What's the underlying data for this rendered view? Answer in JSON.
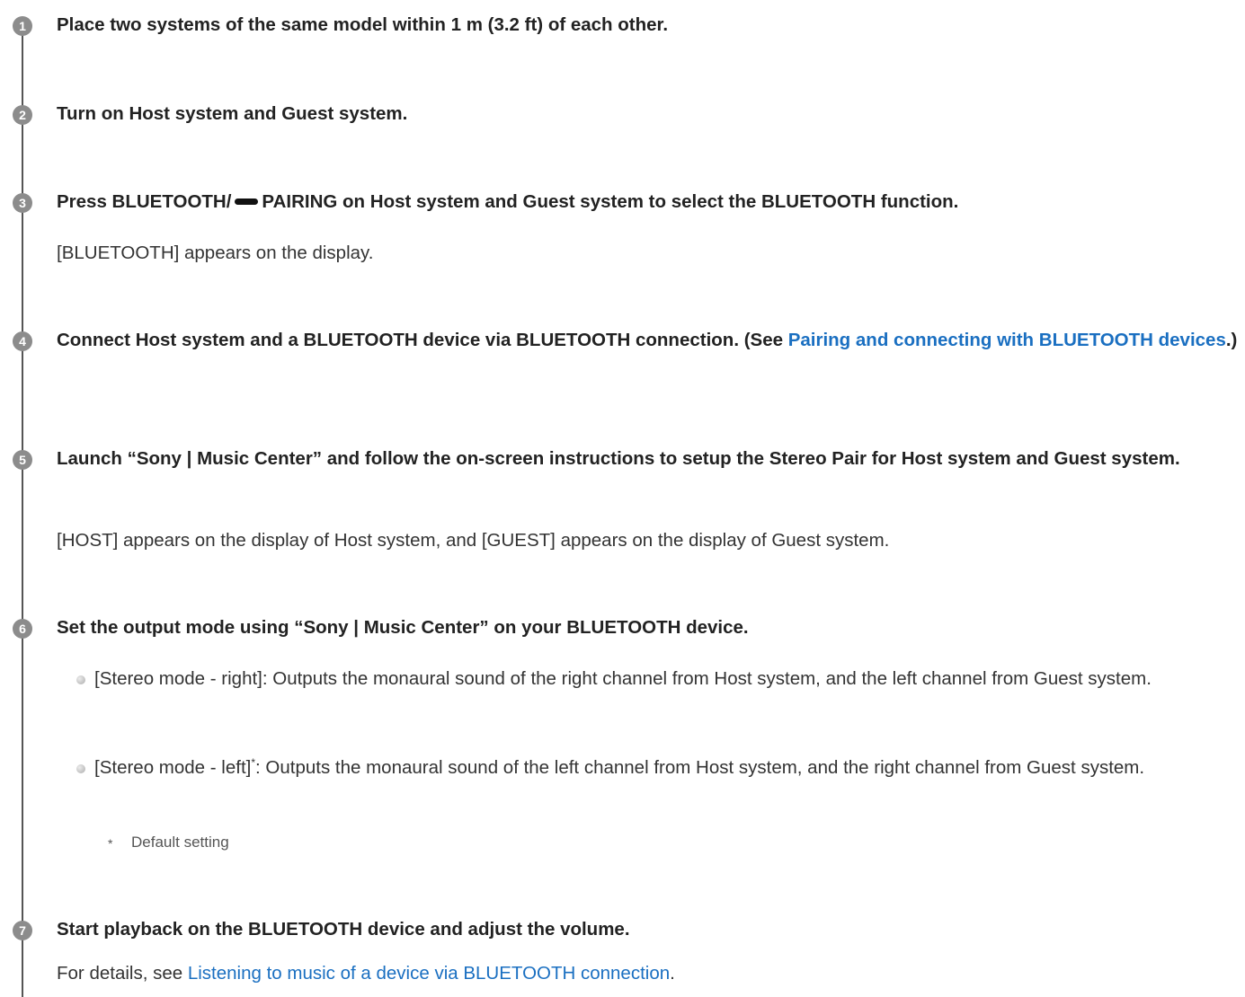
{
  "steps": [
    {
      "number": "1",
      "title": "Place two systems of the same model within 1 m (3.2 ft) of each other."
    },
    {
      "number": "2",
      "title": "Turn on Host system and Guest system."
    },
    {
      "number": "3",
      "title_before_icon": "Press BLUETOOTH/",
      "icon": "pairing-button-icon",
      "title_after_icon": "PAIRING on Host system and Guest system to select the BLUETOOTH function.",
      "body": "[BLUETOOTH] appears on the display."
    },
    {
      "number": "4",
      "title_before_link": "Connect Host system and a BLUETOOTH device via BLUETOOTH connection. (See ",
      "link_text": "Pairing and connecting with BLUETOOTH devices",
      "title_after_link": ".)"
    },
    {
      "number": "5",
      "title": "Launch “Sony | Music Center” and follow the on-screen instructions to setup the Stereo Pair for Host system and Guest system.",
      "body": "[HOST] appears on the display of Host system, and [GUEST] appears on the display of Guest system."
    },
    {
      "number": "6",
      "title": "Set the output mode using “Sony | Music Center” on your BLUETOOTH device.",
      "bullets": [
        {
          "label": "[Stereo mode - right]",
          "text": ": Outputs the monaural sound of the right channel from Host system, and the left channel from Guest system."
        },
        {
          "label": "[Stereo mode - left]",
          "marker": "*",
          "text": ": Outputs the monaural sound of the left channel from Host system, and the right channel from Guest system."
        }
      ],
      "footnote": {
        "marker": "*",
        "text": "Default setting"
      }
    },
    {
      "number": "7",
      "title": "Start playback on the BLUETOOTH device and adjust the volume.",
      "body_before_link": "For details, see ",
      "link_text": "Listening to music of a device via BLUETOOTH connection",
      "body_after_link": "."
    }
  ]
}
